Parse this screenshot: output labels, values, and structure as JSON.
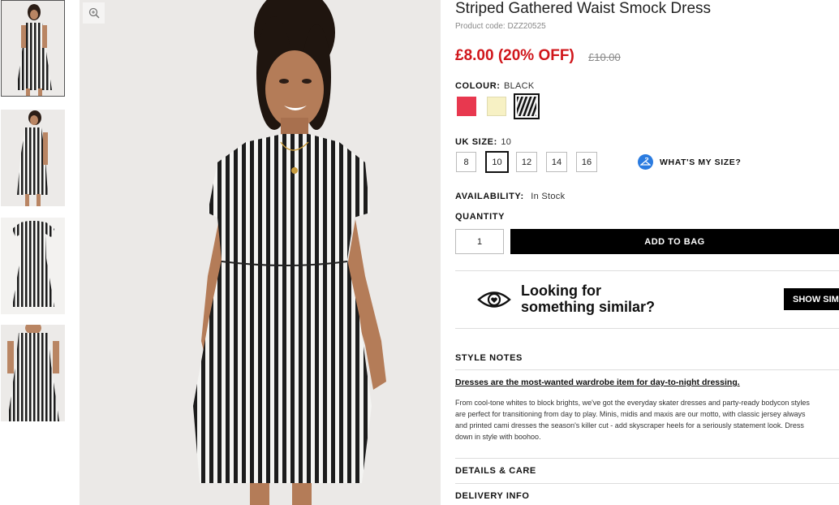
{
  "product": {
    "title": "Striped Gathered Waist Smock Dress",
    "code": "Product code: DZZ20525",
    "price_now": "£8.00 (20% OFF)",
    "price_was": "£10.00"
  },
  "colour": {
    "label": "COLOUR:",
    "selected": "BLACK",
    "swatches": [
      {
        "name": "red",
        "color": "#e8384f"
      },
      {
        "name": "yellow",
        "color": "#f7f1c4"
      },
      {
        "name": "black-stripe",
        "color": "#222222"
      }
    ]
  },
  "size": {
    "label": "UK SIZE:",
    "selected": "10",
    "options": [
      "8",
      "10",
      "12",
      "14",
      "16"
    ],
    "whats_my_size": "WHAT'S MY SIZE?"
  },
  "availability": {
    "label": "AVAILABILITY:",
    "value": "In Stock"
  },
  "quantity": {
    "label": "QUANTITY",
    "value": "1"
  },
  "add_to_bag": "ADD TO BAG",
  "similar": {
    "line1": "Looking for",
    "line2": "something similar?",
    "button": "SHOW SIMILAR"
  },
  "style_notes": {
    "heading": "STYLE NOTES",
    "subheading": "Dresses are the most-wanted wardrobe item for day-to-night dressing.",
    "body": [
      "From cool-tone whites to block brights, we've got the everyday skater dresses and party-ready bodycon styles",
      "are perfect for transitioning from day to play. Minis, midis and maxis are our motto, with classic jersey always",
      "and printed cami dresses the season's killer cut - add skyscraper heels for a seriously statement look. Dress",
      "down in style with boohoo."
    ]
  },
  "sections": {
    "details": "DETAILS & CARE",
    "delivery": "DELIVERY INFO"
  },
  "icons": {
    "zoom": "zoom-in-icon",
    "size_guide": "hanger-icon",
    "similar": "eye-heart-icon"
  },
  "colors": {
    "price": "#d0161b",
    "accent": "#2a7be0",
    "button": "#000000"
  }
}
